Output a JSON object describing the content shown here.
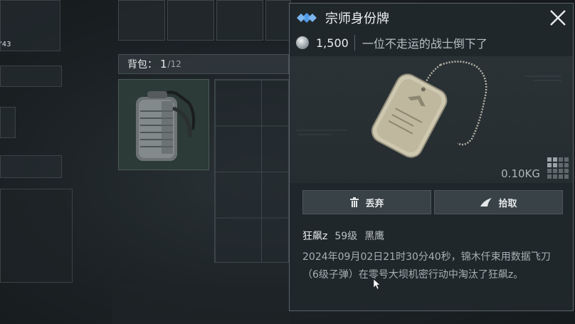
{
  "left_panel": {
    "item_count": "'43"
  },
  "backpack": {
    "label": "背包：",
    "current": "1",
    "capacity": "/12",
    "item_icon": "backpack-icon"
  },
  "detail": {
    "title": "宗师身份牌",
    "title_icon": "diamond-rarity-icon",
    "close_icon": "close-icon",
    "price": "1,500",
    "price_icon": "silver-coin-icon",
    "description": "一位不走运的战士倒下了",
    "weight": "0.10KG",
    "item_icon": "dog-tag-icon",
    "size_icon": "grid-size-icon",
    "actions": [
      {
        "label": "丢弃",
        "icon": "trash-icon"
      },
      {
        "label": "拾取",
        "icon": "pickup-icon"
      }
    ],
    "owner": {
      "name": "狂飙z",
      "level": "59级",
      "rank": "黑鹰"
    },
    "kill_record": "2024年09月02日21时30分40秒，锦木仟束用数据飞刀（6级子弹）在零号大坝机密行动中淘汰了狂飙z。"
  },
  "colors": {
    "accent_blue": "#4f9be6",
    "panel_bg": "#20272b",
    "text": "#e8ecee"
  }
}
